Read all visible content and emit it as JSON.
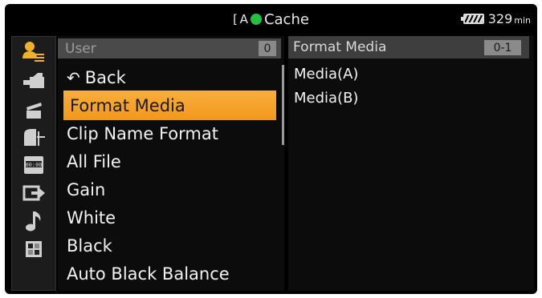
{
  "status": {
    "media_icon": "[ A",
    "title": "Cache",
    "rec_color": "#22c043",
    "battery_value": "329",
    "battery_unit": "min"
  },
  "categories": [
    {
      "name": "user-menu-icon",
      "active": true
    },
    {
      "name": "camera-icon",
      "active": false
    },
    {
      "name": "clapper-icon",
      "active": false
    },
    {
      "name": "paint-icon",
      "active": false
    },
    {
      "name": "timecode-icon",
      "active": false
    },
    {
      "name": "output-icon",
      "active": false
    },
    {
      "name": "audio-note-icon",
      "active": false
    },
    {
      "name": "grid-icon",
      "active": false
    }
  ],
  "menu": {
    "header": "User",
    "header_count": "0",
    "back_icon": "↶",
    "items": [
      "Back",
      "Format Media",
      "Clip Name Format",
      "All File",
      "Gain",
      "White",
      "Black",
      "Auto Black Balance"
    ],
    "selected_index": 1,
    "accent": "#f5a52b"
  },
  "detail": {
    "header": "Format Media",
    "header_count": "0-1",
    "options": [
      "Media(A)",
      "Media(B)"
    ]
  }
}
